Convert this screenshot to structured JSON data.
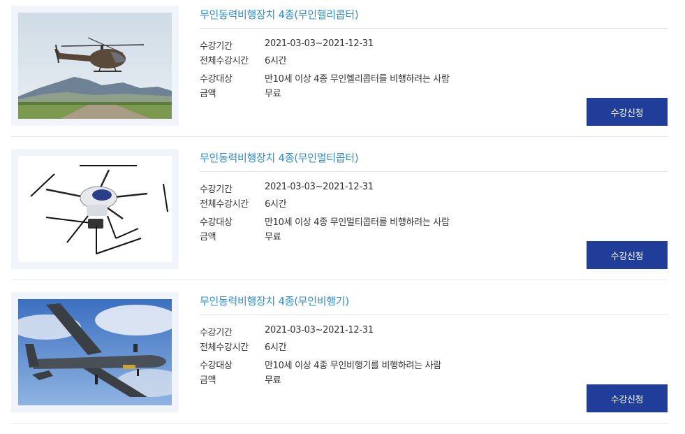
{
  "courses": [
    {
      "title": "무인동력비행장치 4종(무인헬리콥터)",
      "image": "helicopter-photo",
      "period_label": "수강기간",
      "period": "2021-03-03~2021-12-31",
      "hours_label": "전체수강시간",
      "hours": "6시간",
      "target_label": "수강대상",
      "target": "만10세 이상 4종 무인헬리콥터를 비행하려는 사람",
      "price_label": "금액",
      "price": "무료",
      "button": "수강신청"
    },
    {
      "title": "무인동력비행장치 4종(무인멀티콥터)",
      "image": "multicopter-photo",
      "period_label": "수강기간",
      "period": "2021-03-03~2021-12-31",
      "hours_label": "전체수강시간",
      "hours": "6시간",
      "target_label": "수강대상",
      "target": "만10세 이상 4종 무인멀티콥터를 비행하려는 사람",
      "price_label": "금액",
      "price": "무료",
      "button": "수강신청"
    },
    {
      "title": "무인동력비행장치 4종(무인비행기)",
      "image": "airplane-photo",
      "period_label": "수강기간",
      "period": "2021-03-03~2021-12-31",
      "hours_label": "전체수강시간",
      "hours": "6시간",
      "target_label": "수강대상",
      "target": "만10세 이상 4종 무인비행기를 비행하려는 사람",
      "price_label": "금액",
      "price": "무료",
      "button": "수강신청"
    }
  ],
  "colors": {
    "title": "#2d8fd2",
    "button_bg": "#1f3d99",
    "thumb_frame": "#f0f5fb"
  }
}
